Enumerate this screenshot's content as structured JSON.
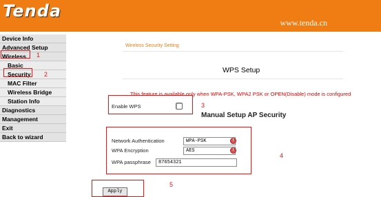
{
  "header": {
    "logo_text": "Tenda",
    "url_text": "www.tenda.cn",
    "brand_color": "#f07d14"
  },
  "sidebar": {
    "items": [
      {
        "label": "Device Info"
      },
      {
        "label": "Advanced Setup"
      },
      {
        "label": "Wireless"
      },
      {
        "label": "Basic"
      },
      {
        "label": "Security"
      },
      {
        "label": "MAC Filter"
      },
      {
        "label": "Wireless Bridge"
      },
      {
        "label": "Station Info"
      },
      {
        "label": "Diagnostics"
      },
      {
        "label": "Management"
      },
      {
        "label": "Exit"
      },
      {
        "label": "Back to wizard"
      }
    ]
  },
  "content": {
    "breadcrumb": "Wireless Security Setting",
    "wps_title": "WPS Setup",
    "notice": "This feature is available only when WPA-PSK, WPA2 PSK or OPEN(Disable) mode is configured",
    "enable_wps_label": "Enable WPS",
    "enable_wps_checked": false,
    "manual_title": "Manual Setup AP Security",
    "network_auth_label": "Network Authentication",
    "network_auth_value": "WPA-PSK",
    "wpa_encryption_label": "WPA Encryption",
    "wpa_encryption_value": "AES",
    "wpa_passphrase_label": "WPA passphrase",
    "wpa_passphrase_value": "87654321",
    "apply_label": "Apply"
  },
  "annotations": {
    "numbers": [
      "1",
      "2",
      "3",
      "4",
      "5"
    ],
    "color": "#ee1111"
  }
}
